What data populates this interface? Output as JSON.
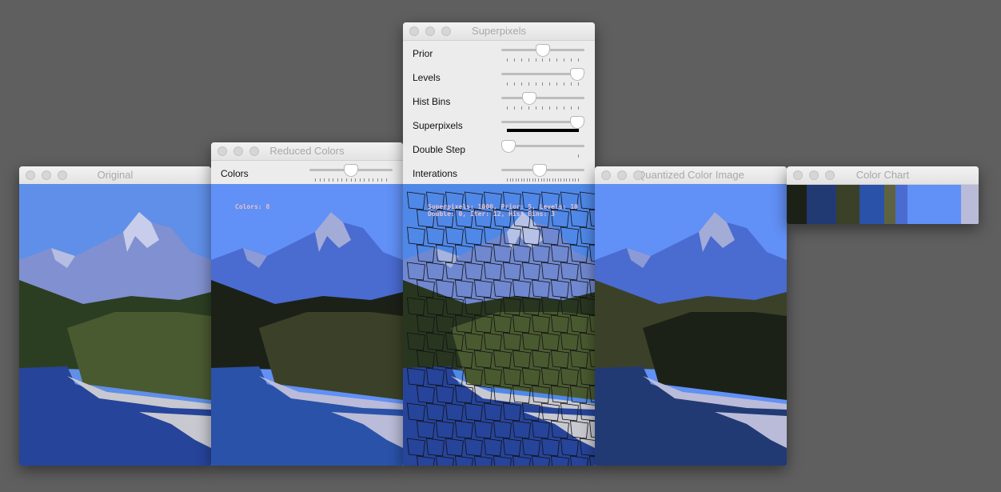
{
  "windows": {
    "original": {
      "title": "Original"
    },
    "reduced": {
      "title": "Reduced Colors",
      "controls": [
        {
          "label": "Colors",
          "value": 8,
          "fraction": 0.5,
          "ticks": 17
        }
      ],
      "overlay": "Colors: 8"
    },
    "superpixels": {
      "title": "Superpixels",
      "controls": [
        {
          "label": "Prior",
          "value": 5,
          "fraction": 0.5,
          "ticks": 11
        },
        {
          "label": "Levels",
          "value": 10,
          "fraction": 1.0,
          "ticks": 11
        },
        {
          "label": "Hist Bins",
          "value": 3,
          "fraction": 0.3,
          "ticks": 11
        },
        {
          "label": "Superpixels",
          "value": 1000,
          "fraction": 1.0,
          "ticks": 0
        },
        {
          "label": "Double Step",
          "value": 0,
          "fraction": 0.0,
          "ticks": 2
        },
        {
          "label": "Interations",
          "value": 12,
          "fraction": 0.45,
          "ticks": 26
        }
      ],
      "overlay_line1": "Superpixels: 1000, Prior: 5, Levels: 10",
      "overlay_line2": "Double: 0, Iter: 12, Hist Bins: 3"
    },
    "quantized": {
      "title": "Quantized Color Image"
    },
    "color_chart": {
      "title": "Color Chart",
      "swatches": [
        {
          "color": "#1c2118",
          "share": 25
        },
        {
          "color": "#223a74",
          "share": 37
        },
        {
          "color": "#3b4128",
          "share": 29
        },
        {
          "color": "#2a52a8",
          "share": 31
        },
        {
          "color": "#5f6240",
          "share": 14
        },
        {
          "color": "#4a6bd0",
          "share": 15
        },
        {
          "color": "#6190f6",
          "share": 67
        },
        {
          "color": "#b9bbd8",
          "share": 22
        }
      ]
    }
  }
}
